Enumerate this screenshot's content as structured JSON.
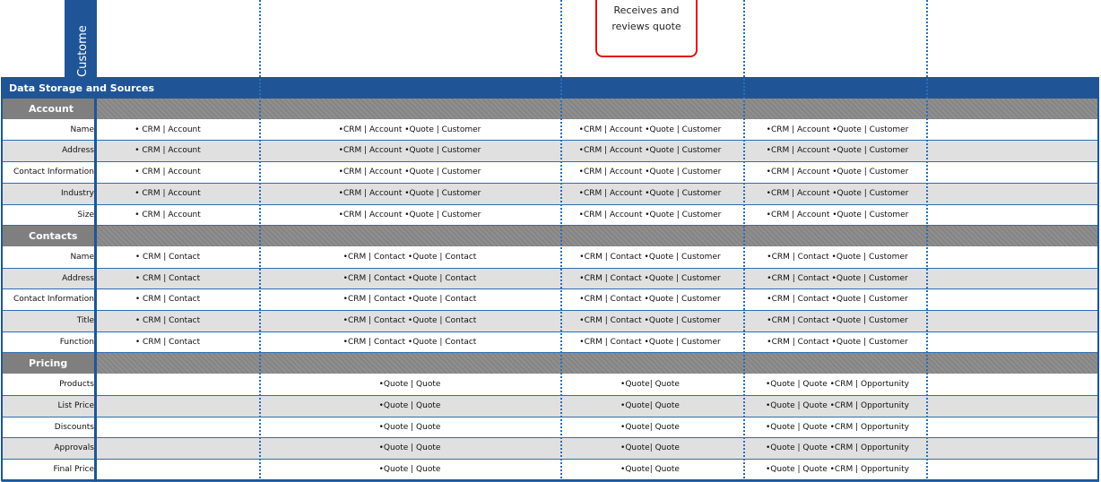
{
  "lane": {
    "label": "Custome"
  },
  "quote_box": {
    "line1": "Receives and",
    "line2": "reviews quote"
  },
  "section": {
    "title": "Data Storage and Sources"
  },
  "groups": [
    {
      "title": "Account",
      "rows": [
        {
          "label": "Name",
          "c1": "• CRM | Account",
          "c2": "•CRM | Account  •Quote | Customer",
          "c3": "•CRM | Account  •Quote | Customer",
          "c4": "•CRM | Account  •Quote | Customer"
        },
        {
          "label": "Address",
          "c1": "• CRM | Account",
          "c2": "•CRM | Account  •Quote | Customer",
          "c3": "•CRM | Account  •Quote | Customer",
          "c4": "•CRM | Account  •Quote | Customer"
        },
        {
          "label": "Contact Information",
          "c1": "• CRM | Account",
          "c2": "•CRM | Account  •Quote | Customer",
          "c3": "•CRM | Account  •Quote | Customer",
          "c4": "•CRM | Account  •Quote | Customer"
        },
        {
          "label": "Industry",
          "c1": "• CRM | Account",
          "c2": "•CRM | Account  •Quote | Customer",
          "c3": "•CRM | Account  •Quote | Customer",
          "c4": "•CRM | Account  •Quote | Customer"
        },
        {
          "label": "Size",
          "c1": "• CRM | Account",
          "c2": "•CRM | Account  •Quote | Customer",
          "c3": "•CRM | Account  •Quote | Customer",
          "c4": "•CRM | Account  •Quote | Customer"
        }
      ]
    },
    {
      "title": "Contacts",
      "rows": [
        {
          "label": "Name",
          "c1": "• CRM | Contact",
          "c2": "•CRM | Contact  •Quote | Contact",
          "c3": "•CRM | Contact  •Quote | Customer",
          "c4": "•CRM | Contact  •Quote | Customer"
        },
        {
          "label": "Address",
          "c1": "• CRM | Contact",
          "c2": "•CRM | Contact  •Quote | Contact",
          "c3": "•CRM | Contact  •Quote | Customer",
          "c4": "•CRM | Contact  •Quote | Customer"
        },
        {
          "label": "Contact Information",
          "c1": "• CRM | Contact",
          "c2": "•CRM | Contact  •Quote | Contact",
          "c3": "•CRM | Contact  •Quote | Customer",
          "c4": "•CRM | Contact  •Quote | Customer"
        },
        {
          "label": "Title",
          "c1": "• CRM | Contact",
          "c2": "•CRM | Contact  •Quote | Contact",
          "c3": "•CRM | Contact  •Quote | Customer",
          "c4": "•CRM | Contact  •Quote | Customer"
        },
        {
          "label": "Function",
          "c1": "• CRM | Contact",
          "c2": "•CRM | Contact  •Quote | Contact",
          "c3": "•CRM | Contact  •Quote | Customer",
          "c4": "•CRM | Contact  •Quote | Customer"
        }
      ]
    },
    {
      "title": "Pricing",
      "rows": [
        {
          "label": "Products",
          "c1": "",
          "c2": "•Quote | Quote",
          "c3": "•Quote| Quote",
          "c4": "•Quote | Quote  •CRM | Opportunity"
        },
        {
          "label": "List Price",
          "c1": "",
          "c2": "•Quote | Quote",
          "c3": "•Quote| Quote",
          "c4": "•Quote | Quote  •CRM | Opportunity"
        },
        {
          "label": "Discounts",
          "c1": "",
          "c2": "•Quote | Quote",
          "c3": "•Quote| Quote",
          "c4": "•Quote | Quote  •CRM | Opportunity"
        },
        {
          "label": "Approvals",
          "c1": "",
          "c2": "•Quote | Quote",
          "c3": "•Quote| Quote",
          "c4": "•Quote | Quote  •CRM | Opportunity"
        },
        {
          "label": "Final Price",
          "c1": "",
          "c2": "•Quote | Quote",
          "c3": "•Quote| Quote",
          "c4": "•Quote | Quote  •CRM | Opportunity"
        }
      ]
    }
  ]
}
